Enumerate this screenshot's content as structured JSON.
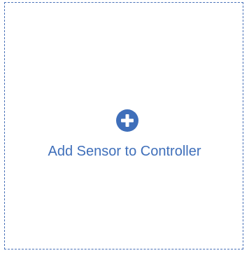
{
  "add_sensor_card": {
    "label": "Add Sensor to Controller",
    "icon": "plus-circle-icon",
    "accent_color": "#3f6fba",
    "border_color": "#4a72b8"
  }
}
